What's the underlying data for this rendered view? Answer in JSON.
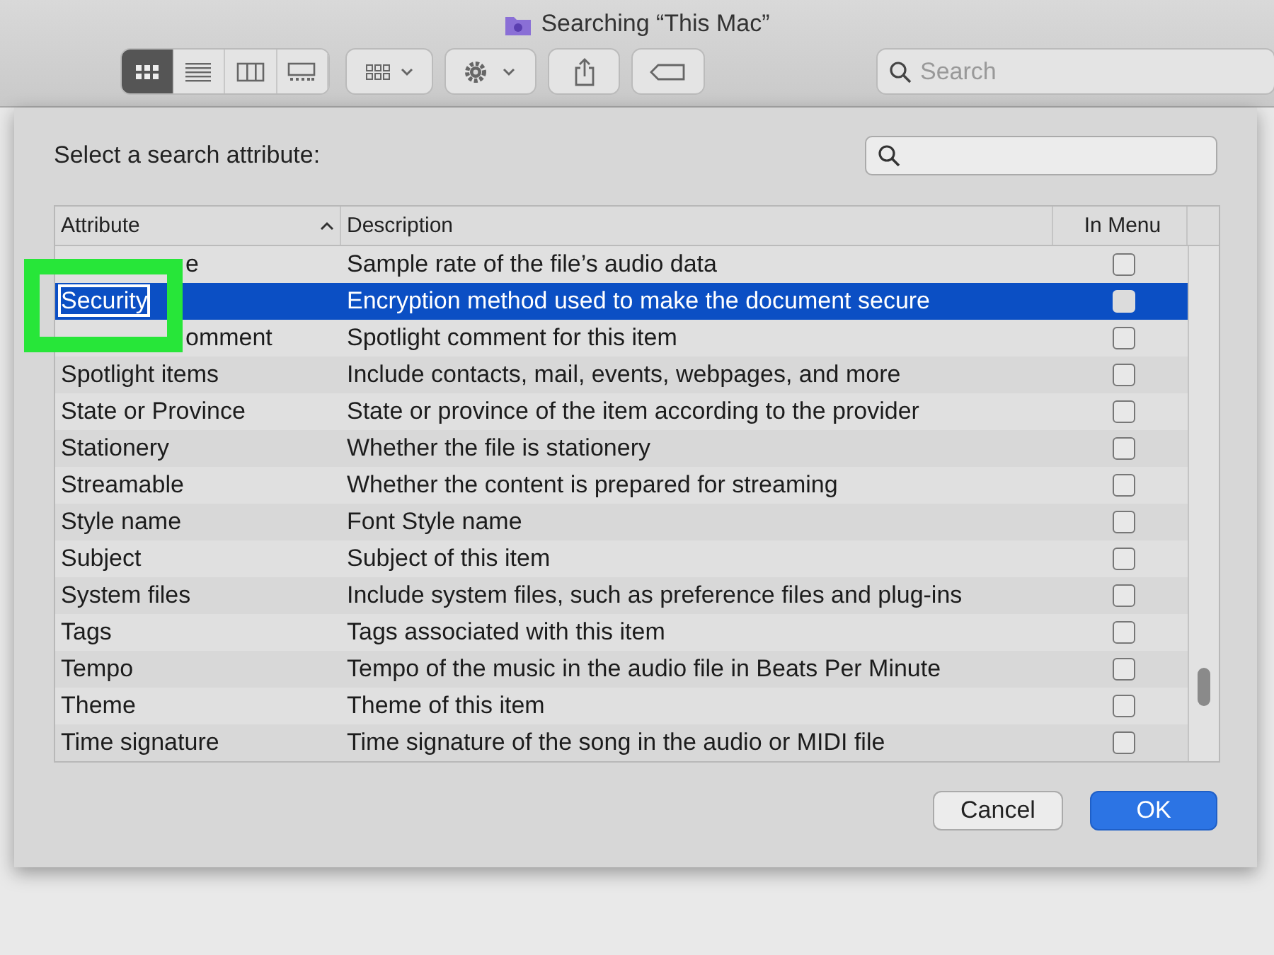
{
  "window": {
    "title": "Searching “This Mac”"
  },
  "toolbar": {
    "view_modes": [
      {
        "selected": true
      },
      {
        "selected": false
      },
      {
        "selected": false
      },
      {
        "selected": false
      }
    ],
    "search": {
      "placeholder": "Search"
    }
  },
  "dialog": {
    "prompt": "Select a search attribute:",
    "table": {
      "columns": [
        "Attribute",
        "Description",
        "In Menu"
      ],
      "rows": [
        {
          "attribute": "e",
          "description": "Sample rate of the file’s audio data",
          "in_menu": false,
          "selected": false,
          "covered": true
        },
        {
          "attribute": "Security",
          "description": "Encryption method used to make the document secure",
          "in_menu": false,
          "selected": true,
          "covered": false
        },
        {
          "attribute": "omment",
          "description": "Spotlight comment for this item",
          "in_menu": false,
          "selected": false,
          "covered": true
        },
        {
          "attribute": "Spotlight items",
          "description": "Include contacts, mail, events, webpages, and more",
          "in_menu": false,
          "selected": false,
          "covered": false
        },
        {
          "attribute": "State or Province",
          "description": "State or province of the item according to the provider",
          "in_menu": false,
          "selected": false,
          "covered": false
        },
        {
          "attribute": "Stationery",
          "description": "Whether the file is stationery",
          "in_menu": false,
          "selected": false,
          "covered": false
        },
        {
          "attribute": "Streamable",
          "description": "Whether the content is prepared for streaming",
          "in_menu": false,
          "selected": false,
          "covered": false
        },
        {
          "attribute": "Style name",
          "description": "Font Style name",
          "in_menu": false,
          "selected": false,
          "covered": false
        },
        {
          "attribute": "Subject",
          "description": "Subject of this item",
          "in_menu": false,
          "selected": false,
          "covered": false
        },
        {
          "attribute": "System files",
          "description": "Include system files, such as preference files and plug-ins",
          "in_menu": false,
          "selected": false,
          "covered": false
        },
        {
          "attribute": "Tags",
          "description": "Tags associated with this item",
          "in_menu": false,
          "selected": false,
          "covered": false
        },
        {
          "attribute": "Tempo",
          "description": "Tempo of the music in the audio file in Beats Per Minute",
          "in_menu": false,
          "selected": false,
          "covered": false
        },
        {
          "attribute": "Theme",
          "description": "Theme of this item",
          "in_menu": false,
          "selected": false,
          "covered": false
        },
        {
          "attribute": "Time signature",
          "description": "Time signature of the song in the audio or MIDI file",
          "in_menu": false,
          "selected": false,
          "covered": false
        }
      ]
    },
    "buttons": [
      {
        "label": "Cancel",
        "kind": "secondary"
      },
      {
        "label": "OK",
        "kind": "primary"
      }
    ]
  }
}
